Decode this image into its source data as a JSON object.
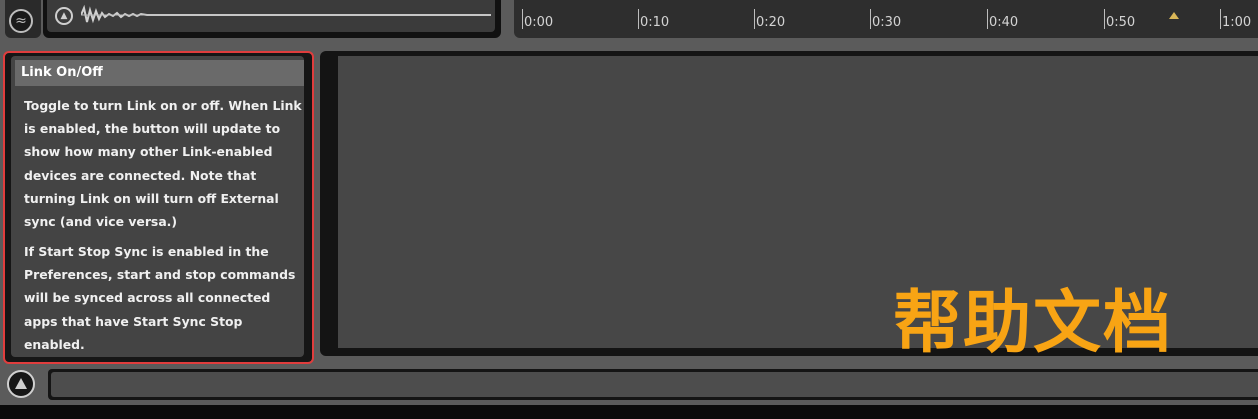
{
  "clip_overview": {
    "icon": "waveform-toggle-icon",
    "clip_icon": "clip-playback-icon"
  },
  "timeline": {
    "ticks": [
      "0:00",
      "0:10",
      "0:20",
      "0:30",
      "0:40",
      "0:50",
      "1:00"
    ],
    "marker_icon": "playhead-marker-icon",
    "marker_color": "#d9b657"
  },
  "info_view": {
    "title": "Link On/Off",
    "paragraph1": "Toggle to turn Link on or off. When Link is enabled, the button will update to show how many other Link-enabled devices are connected. Note that turning Link on will turn off External sync (and vice versa.)",
    "paragraph2": "If Start Stop Sync is enabled in the Preferences, start and stop commands will be synced across all connected apps that have Start Sync Stop enabled.",
    "highlight_color": "#e03d3d"
  },
  "overlay": {
    "caption": "帮助文档",
    "color": "#f8a414"
  },
  "status": {
    "icon": "triangle-status-icon"
  }
}
